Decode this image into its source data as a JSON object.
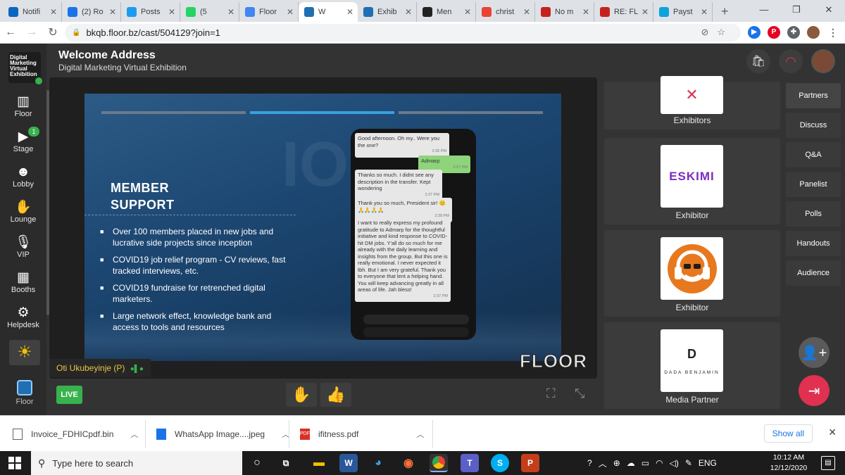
{
  "browser": {
    "tabs": [
      {
        "label": "Notifi",
        "icon": "linkedin-icon",
        "color": "#0a66c2"
      },
      {
        "label": "(2) Ro",
        "icon": "globe-icon",
        "color": "#1a73e8"
      },
      {
        "label": "Posts",
        "icon": "twitter-icon",
        "color": "#1d9bf0"
      },
      {
        "label": "(5",
        "icon": "whatsapp-icon",
        "color": "#25d366"
      },
      {
        "label": "Floor",
        "icon": "docs-icon",
        "color": "#4285f4"
      },
      {
        "label": "W",
        "icon": "floor-icon",
        "color": "#1f6fb2",
        "active": true
      },
      {
        "label": "Exhib",
        "icon": "floor-icon",
        "color": "#1f6fb2"
      },
      {
        "label": "Men",
        "icon": "news-icon",
        "color": "#222222"
      },
      {
        "label": "christ",
        "icon": "google-icon",
        "color": "#ea4335"
      },
      {
        "label": "No m",
        "icon": "gmail-icon",
        "color": "#c5221f"
      },
      {
        "label": "RE: FL",
        "icon": "gmail-icon",
        "color": "#c5221f"
      },
      {
        "label": "Payst",
        "icon": "paystack-icon",
        "color": "#0ba4db"
      }
    ],
    "url": "bkqb.floor.bz/cast/504129?join=1"
  },
  "app": {
    "logo_text": "Digital Marketing Virtual Exhibition",
    "title": "Welcome Address",
    "subtitle": "Digital Marketing Virtual Exhibition",
    "nav": [
      {
        "label": "Floor",
        "icon": "map-icon"
      },
      {
        "label": "Stage",
        "icon": "camera-icon",
        "badge": "1"
      },
      {
        "label": "Lobby",
        "icon": "people-icon"
      },
      {
        "label": "Lounge",
        "icon": "handshake-icon"
      },
      {
        "label": "VIP",
        "icon": "microphone-icon"
      },
      {
        "label": "Booths",
        "icon": "store-icon"
      },
      {
        "label": "Helpdesk",
        "icon": "robot-icon"
      }
    ],
    "floor_button_label": "Floor",
    "speaker": "Oti Ukubeyinje (P)",
    "live_label": "LIVE",
    "watermark": "FLOOR"
  },
  "slide": {
    "title_line1": "MEMBER",
    "title_line2": "SUPPORT",
    "bullets": [
      "Over 100 members placed in new jobs and lucrative side projects since inception",
      "COVID19 job relief program - CV reviews, fast tracked interviews, etc.",
      "COVID19 fundraise for retrenched digital marketers.",
      "Large network effect, knowledge bank and access to tools and resources"
    ],
    "chat": [
      {
        "dir": "in",
        "text": "Good afternoon. Oh my.. Were you the one?",
        "time": "2:26 PM"
      },
      {
        "dir": "out",
        "text": "Admarp",
        "time": "2:27 PM"
      },
      {
        "dir": "in",
        "text": "Thanks so much. I didnt see any description in the transfer. Kept wondering",
        "time": "2:27 PM"
      },
      {
        "dir": "in",
        "text": "Thank you so much, President sir! 😊🙏🙏🙏🙏",
        "time": "2:28 PM"
      },
      {
        "dir": "in",
        "text": "I want to really express my profound gratitude to Admarp for the thoughtful initiative and kind response to COVID-hit DM jobs. Y'all do so much for me already with the daily learning and insights from the group. But this one is really emotional. I never expected it tbh. But I am very grateful. Thank you to everyone that lent a helping hand. You will keep advancing greatly in all areas of life. Jah bless!",
        "time": "2:37 PM"
      }
    ]
  },
  "sponsors": [
    {
      "label": "Exhibitors",
      "logo_text": ""
    },
    {
      "label": "Exhibitor",
      "logo_text": "ESKIMI"
    },
    {
      "label": "Exhibitor",
      "logo_text": ""
    },
    {
      "label": "Media Partner",
      "logo_text": "DADA BENJAMIN",
      "logo_mark": "D"
    }
  ],
  "right_tabs": [
    "Partners",
    "Discuss",
    "Q&A",
    "Panelist",
    "Polls",
    "Handouts",
    "Audience"
  ],
  "downloads": [
    {
      "name": "Invoice_FDHICpdf.bin",
      "type": "file"
    },
    {
      "name": "WhatsApp Image....jpeg",
      "type": "image"
    },
    {
      "name": "ifitness.pdf",
      "type": "pdf"
    }
  ],
  "show_all_label": "Show all",
  "taskbar": {
    "search_placeholder": "Type here to search",
    "language": "ENG",
    "time": "10:12 AM",
    "date": "12/12/2020"
  },
  "colors": {
    "live_green": "#37b24d",
    "exit_red": "#e03150",
    "accent_blue": "#1a73e8",
    "speaker_yellow": "#e8c547"
  }
}
